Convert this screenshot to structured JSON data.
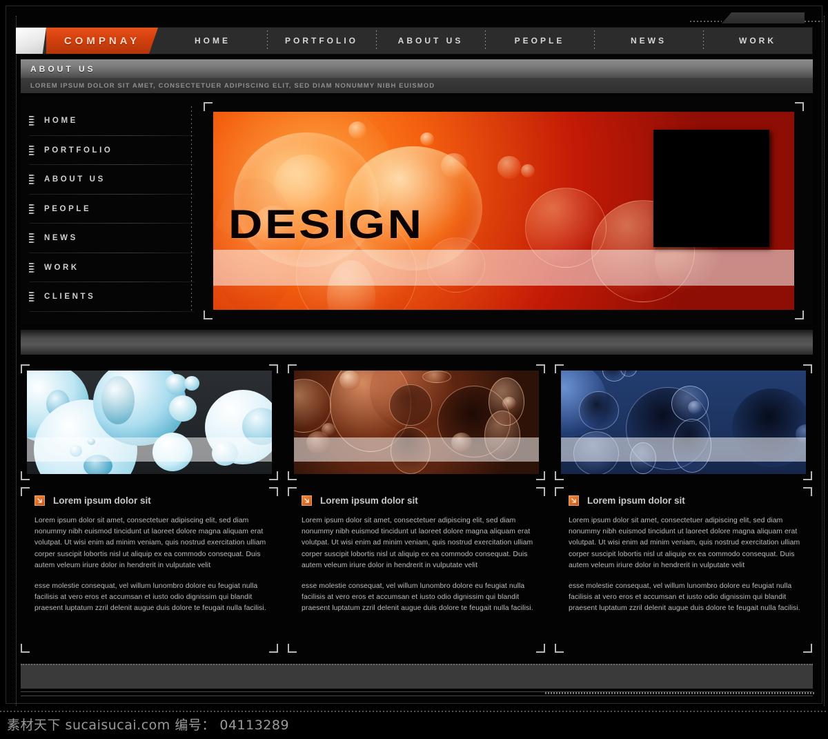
{
  "brand": {
    "name": "COMPNAY",
    "logo_mark": "white-parallelogram"
  },
  "topnav": {
    "items": [
      {
        "label": "HOME"
      },
      {
        "label": "PORTFOLIO"
      },
      {
        "label": "ABOUT US"
      },
      {
        "label": "PEOPLE"
      },
      {
        "label": "NEWS"
      },
      {
        "label": "WORK"
      }
    ]
  },
  "page_header": {
    "title": "ABOUT US",
    "subtitle": "LOREM IPSUM DOLOR SIT AMET, CONSECTETUER ADIPISCING ELIT, SED DIAM NONUMMY NIBH EUISMOD"
  },
  "sidebar": {
    "items": [
      {
        "label": "HOME"
      },
      {
        "label": "PORTFOLIO"
      },
      {
        "label": "ABOUT US"
      },
      {
        "label": "PEOPLE"
      },
      {
        "label": "NEWS"
      },
      {
        "label": "WORK"
      },
      {
        "label": "CLIENTS"
      }
    ]
  },
  "hero": {
    "word": "DESIGN",
    "accent_color": "#d2400d",
    "banner_red": "#c31a06",
    "banner_orange": "#ff9126"
  },
  "cards": [
    {
      "title": "Lorem ipsum dolor sit",
      "icon": "arrow-down-right-icon",
      "theme_color": "#58b7d6",
      "paragraph1": "Lorem ipsum dolor sit amet, consectetuer adipiscing elit, sed diam nonummy nibh euismod  tincidunt ut laoreet dolore magna aliquam erat volutpat. Ut wisi enim ad minim veniam,  quis nostrud exercitation ulliam corper suscipit lobortis nisl ut aliquip ex ea commodo consequat. Duis autem veleum iriure dolor in hendrerit in vulputate velit",
      "paragraph2": "esse molestie consequat, vel willum lunombro dolore eu feugiat nulla facilisis at vero eros et accumsan et iusto odio dignissim qui blandit praesent luptatum zzril delenit augue duis dolore te feugait nulla facilisi."
    },
    {
      "title": "Lorem ipsum dolor sit",
      "icon": "arrow-down-right-icon",
      "theme_color": "#a5522b",
      "paragraph1": "Lorem ipsum dolor sit amet, consectetuer adipiscing elit, sed diam nonummy nibh euismod  tincidunt ut laoreet dolore magna aliquam erat volutpat. Ut wisi enim ad minim veniam,  quis nostrud exercitation ulliam corper suscipit lobortis nisl ut aliquip ex ea commodo consequat. Duis autem veleum iriure dolor in hendrerit in vulputate velit",
      "paragraph2": "esse molestie consequat, vel willum lunombro dolore eu feugiat nulla facilisis at vero eros et accumsan et iusto odio dignissim qui blandit praesent luptatum zzril delenit augue duis dolore te feugait nulla facilisi."
    },
    {
      "title": "Lorem ipsum dolor sit",
      "icon": "arrow-down-right-icon",
      "theme_color": "#2b4a8c",
      "paragraph1": "Lorem ipsum dolor sit amet, consectetuer adipiscing elit, sed diam nonummy nibh euismod  tincidunt ut laoreet dolore magna aliquam erat volutpat. Ut wisi enim ad minim veniam,  quis nostrud exercitation ulliam corper suscipit lobortis nisl ut aliquip ex ea commodo consequat. Duis autem veleum iriure dolor in hendrerit in vulputate velit",
      "paragraph2": "esse molestie consequat, vel willum lunombro dolore eu feugiat nulla facilisis at vero eros et accumsan et iusto odio dignissim qui blandit praesent luptatum zzril delenit augue duis dolore te feugait nulla facilisi."
    }
  ],
  "watermark": {
    "text": "素材天下 sucaisucai.com 编号： 04113289"
  }
}
